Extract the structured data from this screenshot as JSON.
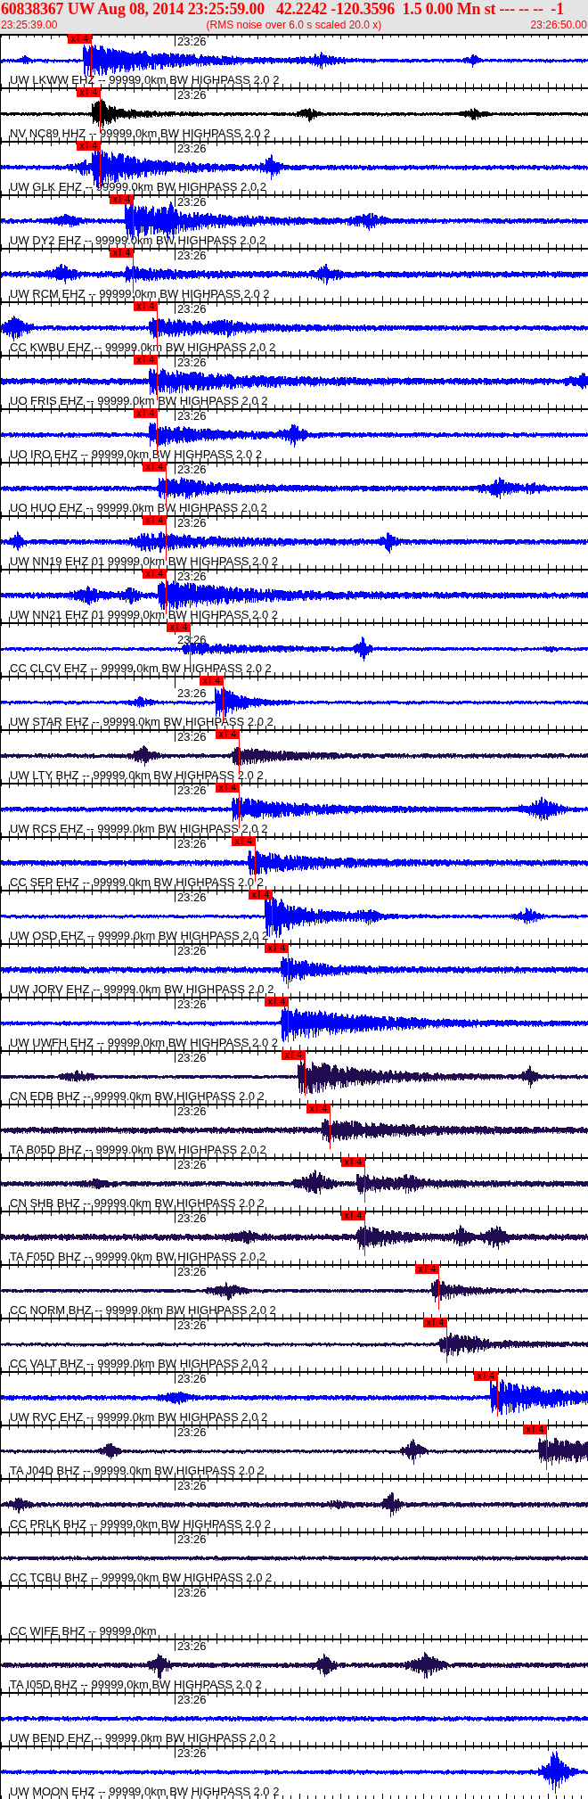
{
  "header": {
    "title": "60838367 UW Aug 08, 2014 23:25:59.00   42.2242 -120.3596  1.5 0.00 Mn st --- -- --  -1",
    "start_time": "23:25:39.00",
    "note": "(RMS noise over 6.0 s scaled 20.0 x)",
    "end_time": "23:26:50.00"
  },
  "traces": [
    {
      "label": "UW LKWW EHZ -- 99999.0km BW HIGHPASS 2.0 2",
      "time_label": "23:26",
      "color": "#0000ff",
      "pick": {
        "label": "xT 4",
        "level": 0.153
      }
    },
    {
      "label": "NV NC89 HHZ -- 99999.0km BW HIGHPASS 2.0 2",
      "time_label": "23:26",
      "color": "#000000",
      "pick": {
        "label": "xT 4",
        "level": 0.168
      }
    },
    {
      "label": "UW GLK EHZ -- 99999.0km BW HIGHPASS 2.0 2",
      "time_label": "23:26",
      "color": "#0000ff",
      "pick": {
        "label": "xT 4",
        "level": 0.168
      }
    },
    {
      "label": "UW DY2 EHZ -- 99999.0km BW HIGHPASS 2.0 2",
      "time_label": "23:26",
      "color": "#0000ff",
      "pick": {
        "label": "xT 4",
        "level": 0.224
      }
    },
    {
      "label": "UW RCM EHZ -- 99999.0km BW HIGHPASS 2.0 2",
      "time_label": "23:26",
      "color": "#0000ff",
      "pick": {
        "label": "xT 4",
        "level": 0.224
      }
    },
    {
      "label": "CC KWBU EHZ -- 99999.0km BW HIGHPASS 2.0 2",
      "time_label": "23:26",
      "color": "#0000ff",
      "pick": {
        "label": "xT 4",
        "level": 0.265
      }
    },
    {
      "label": "UO FRIS EHZ -- 99999.0km BW HIGHPASS 2.0 2",
      "time_label": "23:26",
      "color": "#0000ff",
      "pick": {
        "label": "xT 4",
        "level": 0.265
      }
    },
    {
      "label": "UO IRO EHZ -- 99999.0km BW HIGHPASS 2.0 2",
      "time_label": "23:26",
      "color": "#0000ff",
      "pick": {
        "label": "xT 4",
        "level": 0.265
      }
    },
    {
      "label": "UO HUO EHZ -- 99999.0km BW HIGHPASS 2.0 2",
      "time_label": "23:26",
      "color": "#0000ff",
      "pick": {
        "label": "xT 4",
        "level": 0.28
      }
    },
    {
      "label": "UW NN19 EHZ 01 99999.0km BW HIGHPASS 2.0 2",
      "time_label": "23:26",
      "color": "#0000ff",
      "pick": {
        "label": "xT 4",
        "level": 0.28
      }
    },
    {
      "label": "UW NN21 EHZ 01 99999.0km BW HIGHPASS 2.0 2",
      "time_label": "23:26",
      "color": "#0000ff",
      "pick": {
        "label": "xT 4",
        "level": 0.28
      }
    },
    {
      "label": "CC CLCV EHZ -- 99999.0km BW HIGHPASS 2.0 2",
      "time_label": "23:26",
      "color": "#0000ff",
      "pick": {
        "label": "xT 4",
        "level": 0.321
      }
    },
    {
      "label": "UW STAR EHZ -- 99999.0km BW HIGHPASS 2.0 2",
      "time_label": "23:26",
      "color": "#0000ff",
      "pick": {
        "label": "xT 4",
        "level": 0.377
      }
    },
    {
      "label": "UW LTY BHZ -- 99999.0km BW HIGHPASS 2.0 2",
      "time_label": "23:26",
      "color": "#200a50",
      "pick": {
        "label": "xT 4",
        "level": 0.405
      }
    },
    {
      "label": "UW RCS EHZ -- 99999.0km BW HIGHPASS 2.0 2",
      "time_label": "23:26",
      "color": "#0000ff",
      "pick": {
        "label": "xT 4",
        "level": 0.405
      }
    },
    {
      "label": "CC SEP EHZ -- 99999.0km BW HIGHPASS 2.0 2",
      "time_label": "23:26",
      "color": "#0000ff",
      "pick": {
        "label": "xT 4",
        "level": 0.432
      }
    },
    {
      "label": "UW OSD EHZ -- 99999.0km BW HIGHPASS 2.0 2",
      "time_label": "23:26",
      "color": "#0000ff",
      "pick": {
        "label": "xT 4",
        "level": 0.461
      }
    },
    {
      "label": "UW JORV EHZ -- 99999.0km BW HIGHPASS 2.0 2",
      "time_label": "23:26",
      "color": "#0000ff",
      "pick": {
        "label": "xT 4",
        "level": 0.488
      }
    },
    {
      "label": "UW UWFH EHZ -- 99999.0km BW HIGHPASS 2.0 2",
      "time_label": "23:26",
      "color": "#0000ff",
      "pick": {
        "label": "xT 4",
        "level": 0.488
      }
    },
    {
      "label": "CN EDB BHZ -- 99999.0km BW HIGHPASS 2.0 2",
      "time_label": "23:26",
      "color": "#200a50",
      "pick": {
        "label": "xT 4",
        "level": 0.517
      }
    },
    {
      "label": "TA B05D BHZ -- 99999.0km BW HIGHPASS 2.0 2",
      "time_label": "23:26",
      "color": "#200a50",
      "pick": {
        "label": "xT 4",
        "level": 0.559
      }
    },
    {
      "label": "CN SHB BHZ -- 99999.0km BW HIGHPASS 2.0 2",
      "time_label": "23:26",
      "color": "#200a50",
      "pick": {
        "label": "xT 4",
        "level": 0.618
      }
    },
    {
      "label": "TA F05D BHZ -- 99999.0km BW HIGHPASS 2.0 2",
      "time_label": "23:26",
      "color": "#200a50",
      "pick": {
        "label": "xT 4",
        "level": 0.618
      }
    },
    {
      "label": "CC NORM BHZ -- 99999.0km BW HIGHPASS 2.0 2",
      "time_label": "23:26",
      "color": "#200a50",
      "pick": {
        "label": "xT 4",
        "level": 0.744
      }
    },
    {
      "label": "CC VALT BHZ -- 99999.0km BW HIGHPASS 2.0 2",
      "time_label": "23:26",
      "color": "#200a50",
      "pick": {
        "label": "xT 4",
        "level": 0.758
      }
    },
    {
      "label": "UW RVC EHZ -- 99999.0km BW HIGHPASS 2.0 2",
      "time_label": "23:26",
      "color": "#0000ff",
      "pick": {
        "label": "xT 4",
        "level": 0.844
      }
    },
    {
      "label": "TA J04D BHZ -- 99999.0km BW HIGHPASS 2.0 2",
      "time_label": "23:26",
      "color": "#200a50",
      "pick": {
        "label": "xT 4",
        "level": 0.927
      }
    },
    {
      "label": "CC PRLK BHZ -- 99999.0km BW HIGHPASS 2.0 2",
      "time_label": "23:26",
      "color": "#200a50"
    },
    {
      "label": "CC TCBU BHZ -- 99999.0km BW HIGHPASS 2.0 2",
      "time_label": "23:26",
      "color": "#200a50"
    },
    {
      "label": "CC WIFE BHZ -- 99999.0km",
      "time_label": "23:26"
    },
    {
      "label": "TA I05D BHZ -- 99999.0km BW HIGHPASS 2.0 2",
      "time_label": "23:26",
      "color": "#200a50"
    },
    {
      "label": "UW BEND EHZ -- 99999.0km BW HIGHPASS 2.0 2",
      "time_label": "23:26",
      "color": "#0000ff"
    },
    {
      "label": "UW MOON EHZ -- 99999.0km BW HIGHPASS 2.0 2",
      "time_label": "23:26",
      "color": "#0000ff"
    }
  ]
}
